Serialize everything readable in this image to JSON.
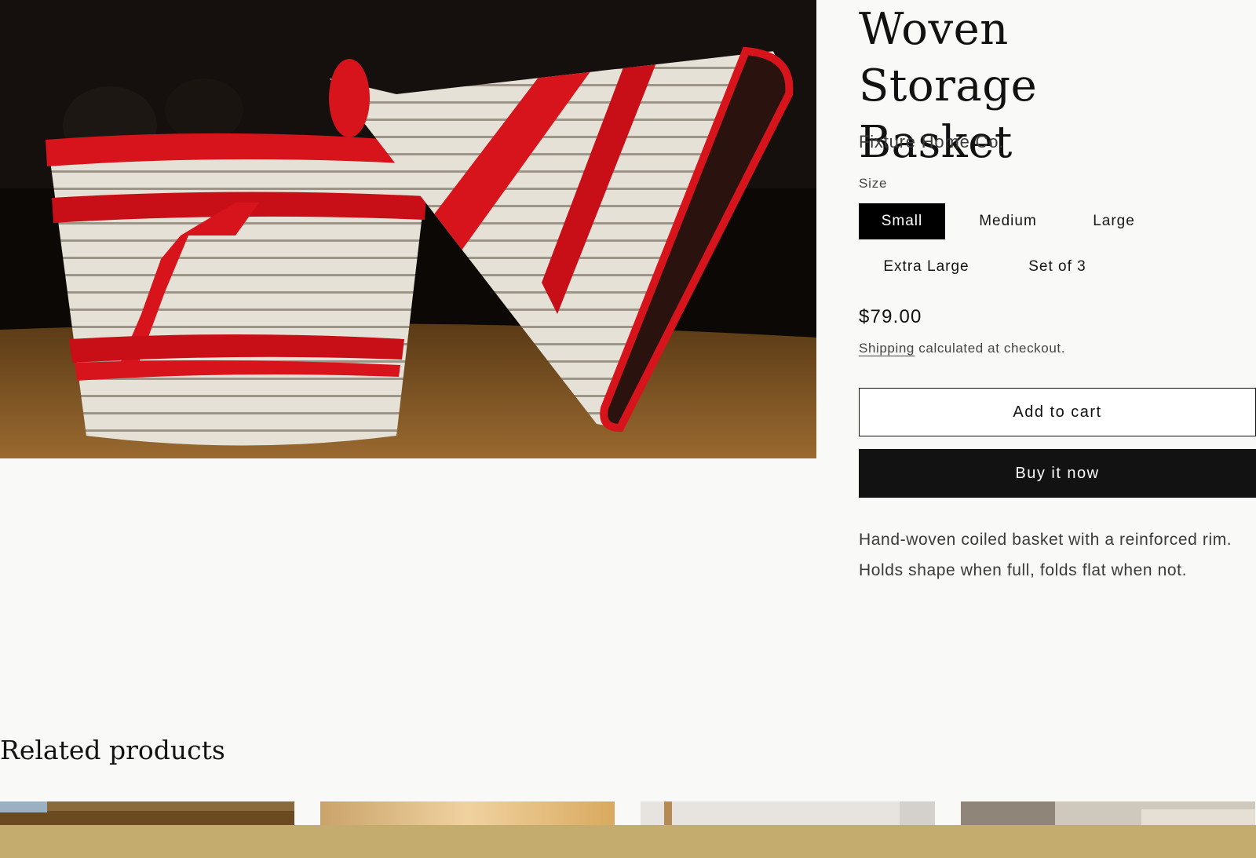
{
  "product": {
    "title": "Woven Storage Basket",
    "vendor": "Fixture Home Co.",
    "size_label": "Size",
    "sizes": [
      "Small",
      "Medium",
      "Large",
      "Extra Large",
      "Set of 3"
    ],
    "selected_size": "Small",
    "price": "$79.00",
    "shipping_link": "Shipping",
    "shipping_text": " calculated at checkout.",
    "add_to_cart": "Add to cart",
    "buy_now": "Buy it now",
    "description": "Hand-woven coiled basket with a reinforced rim. Holds shape when full, folds flat when not."
  },
  "related": {
    "title": "Related products"
  },
  "colors": {
    "background": "#f9f9f7",
    "accent_dark": "#121212",
    "basket_red": "#d7141b",
    "basket_cream": "#e9e4da",
    "footer_bar": "#c4ab6e"
  }
}
